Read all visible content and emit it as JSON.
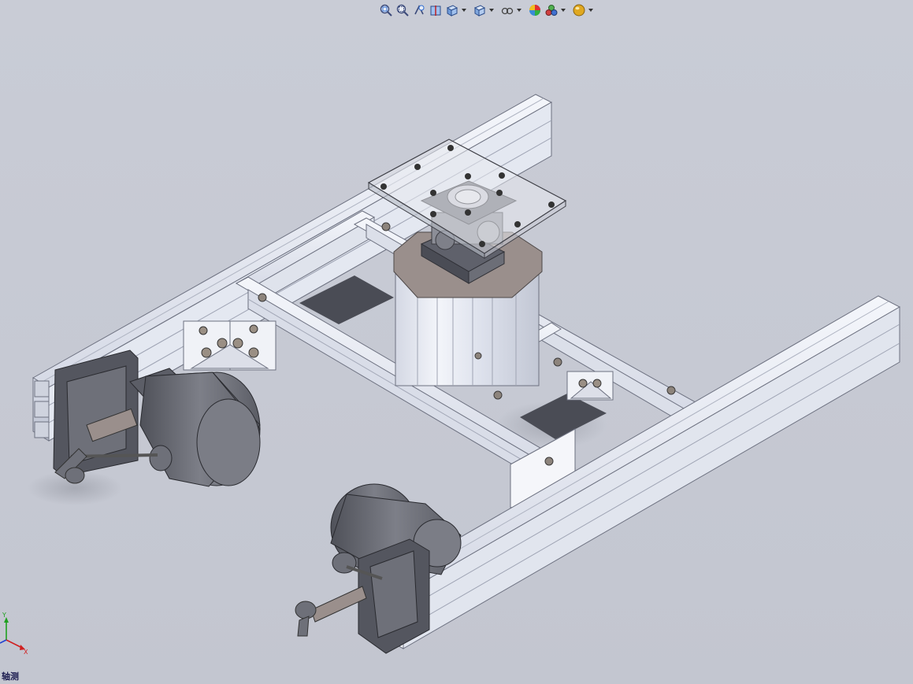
{
  "toolbar": {
    "buttons": [
      {
        "icon": "zoom-to-fit-icon",
        "has_dropdown": false
      },
      {
        "icon": "zoom-to-area-icon",
        "has_dropdown": false
      },
      {
        "icon": "previous-view-icon",
        "has_dropdown": false
      },
      {
        "icon": "section-view-icon",
        "has_dropdown": false
      },
      {
        "icon": "view-orientation-icon",
        "has_dropdown": true
      },
      {
        "icon": "display-style-icon",
        "has_dropdown": true
      },
      {
        "icon": "hide-show-items-icon",
        "has_dropdown": true
      },
      {
        "icon": "edit-appearance-icon",
        "has_dropdown": false
      },
      {
        "icon": "apply-scene-icon",
        "has_dropdown": true
      },
      {
        "icon": "view-settings-icon",
        "has_dropdown": true
      }
    ]
  },
  "triad": {
    "y_label": "Y",
    "x_label": "X",
    "x_color": "#d02020",
    "y_color": "#20a020",
    "z_color": "#2040d0"
  },
  "view": {
    "label": "轴测"
  },
  "colors": {
    "background": "#c6c9d3",
    "profile": "#e8ebf3",
    "motor": "#6e7079",
    "plate": "#9a8f8c"
  }
}
